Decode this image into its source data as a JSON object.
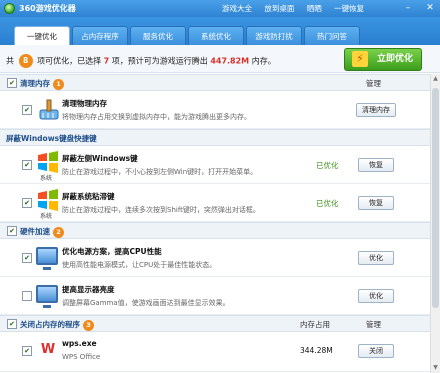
{
  "window": {
    "title": "360游戏优化器",
    "links": [
      "游戏大全",
      "放到桌面",
      "晒晒",
      "一键恢复"
    ]
  },
  "tabs": [
    "一键优化",
    "占内存程序",
    "服务优化",
    "系统优化",
    "游戏防打扰",
    "热门问答"
  ],
  "summary": {
    "prefix": "共",
    "total": "8",
    "mid1": "项可优化，已选择",
    "selected": "7",
    "mid2": "项，预计可为游戏运行腾出",
    "memory": "447.82M",
    "suffix": "内存。",
    "button": "立即优化"
  },
  "sections": {
    "memory": {
      "label": "清理内存",
      "count": "1",
      "col_manage": "管理"
    },
    "hotkeys": {
      "label": "屏蔽Windows键盘快捷键"
    },
    "hardware": {
      "label": "硬件加速",
      "count": "2"
    },
    "programs": {
      "label": "关闭占内存的程序",
      "count": "3",
      "col_mem": "内存占用",
      "col_manage": "管理"
    }
  },
  "rows": {
    "clean": {
      "title": "清理物理内存",
      "desc": "将物理内存占用交换到虚拟内存中，能为游戏腾出更多内存。",
      "button": "清理内存"
    },
    "winkey": {
      "title": "屏蔽左侧Windows键",
      "desc": "防止在游戏过程中，不小心按到左侧Win键时，打开开始菜单。",
      "status": "已优化",
      "button": "恢复",
      "tag": "系统"
    },
    "stickykey": {
      "title": "屏蔽系统粘滞键",
      "desc": "防止在游戏过程中，连续多次按到Shift键时，突然弹出对话框。",
      "status": "已优化",
      "button": "恢复",
      "tag": "系统"
    },
    "power": {
      "title": "优化电源方案，提高CPU性能",
      "desc": "使用高性能电源模式，让CPU处于最佳性能状态。",
      "button": "优化"
    },
    "brightness": {
      "title": "提高显示器亮度",
      "desc": "调整屏幕Gamma值，使游戏画面达到最佳显示效果。",
      "button": "优化"
    },
    "wps": {
      "title": "wps.exe",
      "desc": "WPS Office",
      "memory": "344.28M",
      "button": "关闭"
    }
  }
}
